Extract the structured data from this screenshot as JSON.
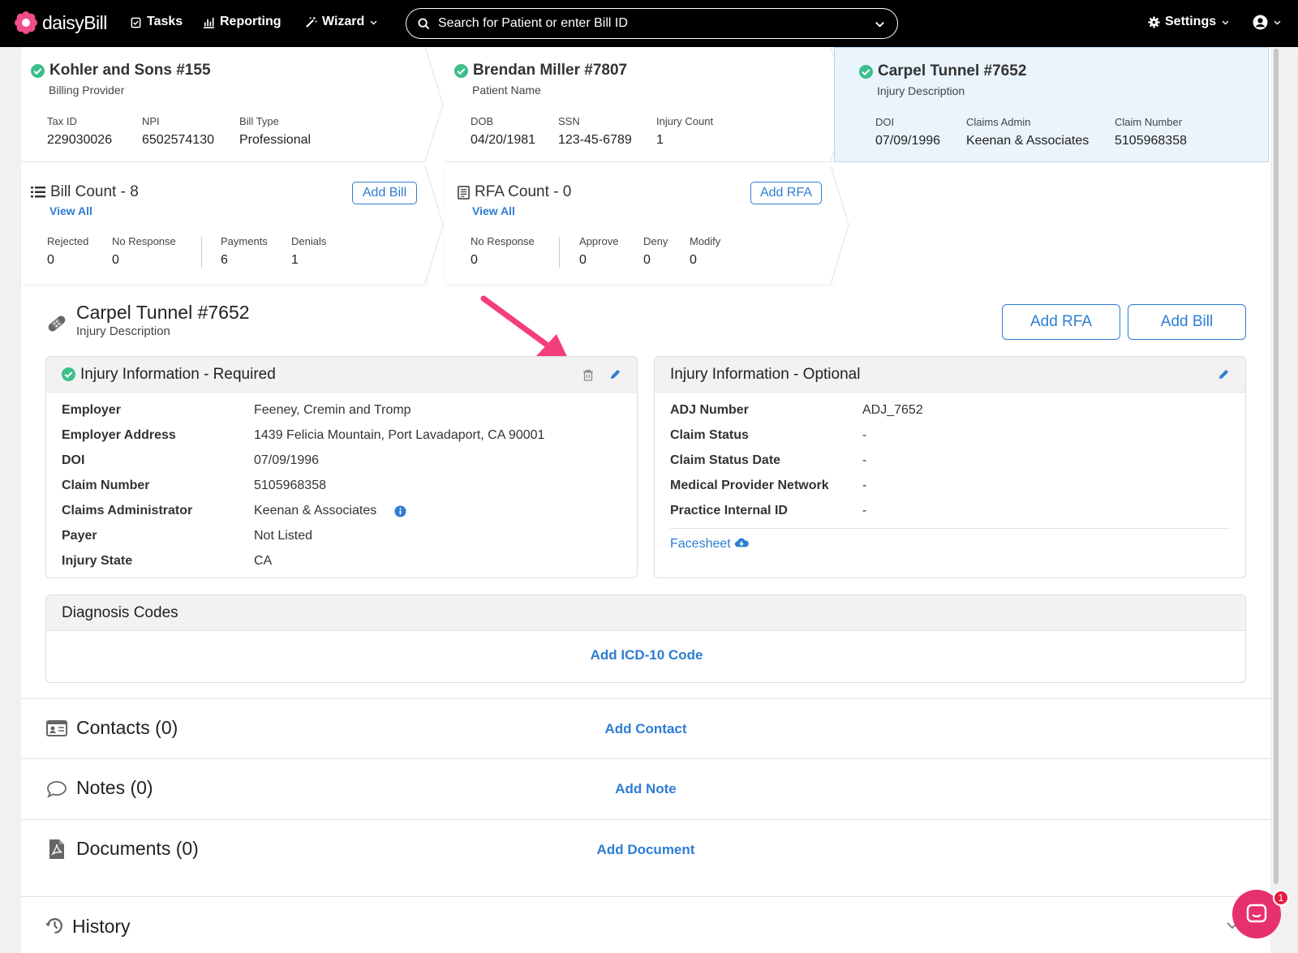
{
  "nav": {
    "logo_text": "daisyBill",
    "tasks": "Tasks",
    "reporting": "Reporting",
    "wizard": "Wizard",
    "search_placeholder": "Search for Patient or enter Bill ID",
    "settings": "Settings"
  },
  "provider": {
    "title": "Kohler and Sons #155",
    "subtitle": "Billing Provider",
    "tax_id_label": "Tax ID",
    "tax_id": "229030026",
    "npi_label": "NPI",
    "npi": "6502574130",
    "bill_type_label": "Bill Type",
    "bill_type": "Professional"
  },
  "patient": {
    "title": "Brendan Miller #7807",
    "subtitle": "Patient Name",
    "dob_label": "DOB",
    "dob": "04/20/1981",
    "ssn_label": "SSN",
    "ssn": "123-45-6789",
    "injury_count_label": "Injury Count",
    "injury_count": "1"
  },
  "injury": {
    "title": "Carpel Tunnel #7652",
    "subtitle": "Injury Description",
    "doi_label": "DOI",
    "doi": "07/09/1996",
    "claims_admin_label": "Claims Admin",
    "claims_admin": "Keenan & Associates",
    "claim_number_label": "Claim Number",
    "claim_number": "5105968358"
  },
  "bills": {
    "title": "Bill Count - 8",
    "add": "Add Bill",
    "view_all": "View All",
    "rejected_label": "Rejected",
    "rejected": "0",
    "no_response_label": "No Response",
    "no_response": "0",
    "payments_label": "Payments",
    "payments": "6",
    "denials_label": "Denials",
    "denials": "1"
  },
  "rfa": {
    "title": "RFA Count - 0",
    "add": "Add RFA",
    "view_all": "View All",
    "no_response_label": "No Response",
    "no_response": "0",
    "approve_label": "Approve",
    "approve": "0",
    "deny_label": "Deny",
    "deny": "0",
    "modify_label": "Modify",
    "modify": "0"
  },
  "section": {
    "title": "Carpel Tunnel #7652",
    "subtitle": "Injury Description",
    "add_rfa": "Add RFA",
    "add_bill": "Add Bill"
  },
  "required": {
    "title": "Injury Information - Required",
    "rows": [
      {
        "k": "Employer",
        "v": "Feeney, Cremin and Tromp"
      },
      {
        "k": "Employer Address",
        "v": "1439 Felicia Mountain, Port Lavadaport, CA 90001"
      },
      {
        "k": "DOI",
        "v": "07/09/1996"
      },
      {
        "k": "Claim Number",
        "v": "5105968358"
      },
      {
        "k": "Claims Administrator",
        "v": "Keenan & Associates"
      },
      {
        "k": "Payer",
        "v": "Not Listed"
      },
      {
        "k": "Injury State",
        "v": "CA"
      }
    ]
  },
  "optional": {
    "title": "Injury Information - Optional",
    "rows": [
      {
        "k": "ADJ Number",
        "v": "ADJ_7652"
      },
      {
        "k": "Claim Status",
        "v": "-"
      },
      {
        "k": "Claim Status Date",
        "v": "-"
      },
      {
        "k": "Medical Provider Network",
        "v": "-"
      },
      {
        "k": "Practice Internal ID",
        "v": "-"
      }
    ],
    "facesheet": "Facesheet"
  },
  "diagnosis": {
    "title": "Diagnosis Codes",
    "add": "Add ICD-10 Code"
  },
  "contacts": {
    "title": "Contacts (0)",
    "add": "Add Contact"
  },
  "notes": {
    "title": "Notes (0)",
    "add": "Add Note"
  },
  "documents": {
    "title": "Documents (0)",
    "add": "Add Document"
  },
  "history": {
    "title": "History"
  },
  "chat": {
    "badge": "1"
  },
  "colors": {
    "accent": "#2d7dd2",
    "success": "#3dbf8a",
    "arrow": "#f43f7a"
  }
}
